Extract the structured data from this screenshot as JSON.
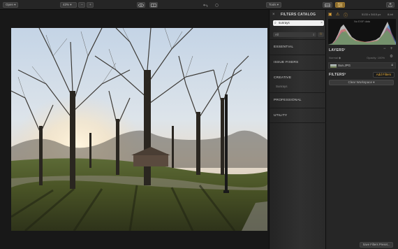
{
  "toolbar": {
    "open_label": "Open ▾",
    "zoom_label": "43% ▾",
    "zoom_out": "−",
    "zoom_in": "+",
    "undo_icon": "undo-icon",
    "redo_icon": "redo-icon",
    "tools_label": "Tools ▾",
    "export_icon": "export-icon"
  },
  "catalog": {
    "close": "×",
    "title": "FILTERS CATALOG",
    "search_value": "sunrays",
    "search_clear": "×",
    "filter_value": "All",
    "fav_glyph": "☆",
    "sections": [
      {
        "name": "ESSENTIAL"
      },
      {
        "name": "ISSUE FIXERS"
      },
      {
        "name": "CREATIVE",
        "sub": "Sunrays"
      },
      {
        "name": "PROFESSIONAL"
      },
      {
        "name": "UTILITY"
      }
    ]
  },
  "right_panel": {
    "dims": "5133 x 3415 px",
    "bits": "8-bit",
    "histo_label": "No EXIF data",
    "layers_title": "LAYERS",
    "layers_toggle": "▾",
    "layers_minus": "−",
    "layers_plus": "+",
    "blend_label": "Normal ◆",
    "opacity_label": "Opacity: 100%",
    "layer_name": "Sun.JPG",
    "filters_title": "FILTERS",
    "add_filters": "Add Filters",
    "clear_workspace": "Clear Workspace ▾",
    "save_preset": "Save Filters Preset..."
  },
  "colors": {
    "accent": "#e0a43a",
    "panel": "#262626",
    "canvas": "#181818"
  }
}
